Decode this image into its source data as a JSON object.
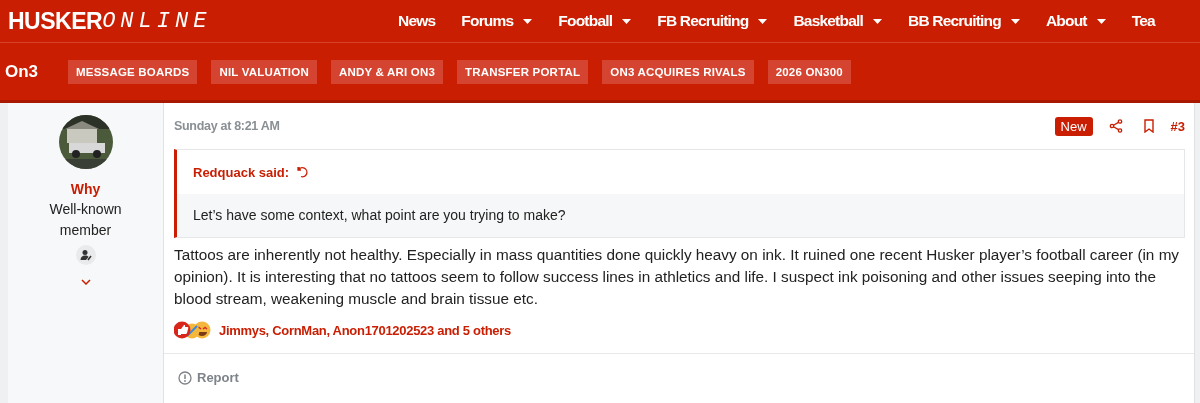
{
  "site": {
    "logo_bold": "HUSKER",
    "logo_light": "ONLINE"
  },
  "nav": [
    {
      "label": "News",
      "dropdown": false
    },
    {
      "label": "Forums",
      "dropdown": true
    },
    {
      "label": "Football",
      "dropdown": true
    },
    {
      "label": "FB Recruiting",
      "dropdown": true
    },
    {
      "label": "Basketball",
      "dropdown": true
    },
    {
      "label": "BB Recruiting",
      "dropdown": true
    },
    {
      "label": "About",
      "dropdown": true
    },
    {
      "label": "Tea",
      "dropdown": false
    }
  ],
  "subnav": {
    "brand": "On3",
    "links": [
      "MESSAGE BOARDS",
      "NIL VALUATION",
      "ANDY & ARI ON3",
      "TRANSFER PORTAL",
      "ON3 ACQUIRES RIVALS",
      "2026 ON300"
    ]
  },
  "author": {
    "name": "Why",
    "title": "Well-known member"
  },
  "post": {
    "time": "Sunday at 8:21 AM",
    "badge": "New",
    "number": "#3",
    "quote": {
      "author": "Redquack said:",
      "text": "Let’s have some context, what point are you trying to make?"
    },
    "body": "Tattoos are inherently not healthy. Especially in mass quantities done quickly heavy on ink. It ruined one recent Husker player’s football career (in my opinion). It is interesting that no tattoos seem to follow success lines in athletics and life. I suspect ink poisoning and other issues seeping into the blood stream, weakening muscle and brain tissue etc.",
    "reactions": "Jimmys, CornMan, Anon1701202523 and 5 others",
    "report": "Report"
  }
}
